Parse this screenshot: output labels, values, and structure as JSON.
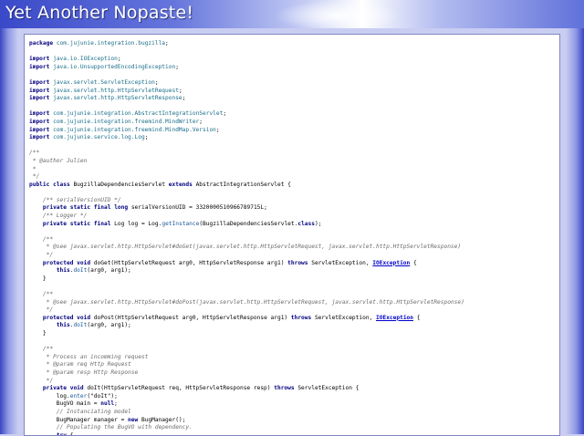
{
  "site": {
    "title": "Yet Another Nopaste!"
  },
  "code_lines": [
    [
      [
        "kw",
        "package"
      ],
      [
        "pl",
        " "
      ],
      [
        "pkg",
        "com.jujunie.integration.bugzilla"
      ],
      [
        "pl",
        ";"
      ]
    ],
    [],
    [
      [
        "kw",
        "import"
      ],
      [
        "pl",
        " "
      ],
      [
        "pkg",
        "java.io.IOException"
      ],
      [
        "pl",
        ";"
      ]
    ],
    [
      [
        "kw",
        "import"
      ],
      [
        "pl",
        " "
      ],
      [
        "pkg",
        "java.io.UnsupportedEncodingException"
      ],
      [
        "pl",
        ";"
      ]
    ],
    [],
    [
      [
        "kw",
        "import"
      ],
      [
        "pl",
        " "
      ],
      [
        "pkg",
        "javax.servlet.ServletException"
      ],
      [
        "pl",
        ";"
      ]
    ],
    [
      [
        "kw",
        "import"
      ],
      [
        "pl",
        " "
      ],
      [
        "pkg",
        "javax.servlet.http.HttpServletRequest"
      ],
      [
        "pl",
        ";"
      ]
    ],
    [
      [
        "kw",
        "import"
      ],
      [
        "pl",
        " "
      ],
      [
        "pkg",
        "javax.servlet.http.HttpServletResponse"
      ],
      [
        "pl",
        ";"
      ]
    ],
    [],
    [
      [
        "kw",
        "import"
      ],
      [
        "pl",
        " "
      ],
      [
        "pkg",
        "com.jujunie.integration.AbstractIntegrationServlet"
      ],
      [
        "pl",
        ";"
      ]
    ],
    [
      [
        "kw",
        "import"
      ],
      [
        "pl",
        " "
      ],
      [
        "pkg",
        "com.jujunie.integration.freemind.MindWriter"
      ],
      [
        "pl",
        ";"
      ]
    ],
    [
      [
        "kw",
        "import"
      ],
      [
        "pl",
        " "
      ],
      [
        "pkg",
        "com.jujunie.integration.freemind.MindMap.Version"
      ],
      [
        "pl",
        ";"
      ]
    ],
    [
      [
        "kw",
        "import"
      ],
      [
        "pl",
        " "
      ],
      [
        "pkg",
        "com.jujunie.service.log.Log"
      ],
      [
        "pl",
        ";"
      ]
    ],
    [],
    [
      [
        "cm",
        "/**"
      ]
    ],
    [
      [
        "cm",
        " * @author Julien"
      ]
    ],
    [
      [
        "cm",
        " *"
      ]
    ],
    [
      [
        "cm",
        " */"
      ]
    ],
    [
      [
        "kw",
        "public"
      ],
      [
        "pl",
        " "
      ],
      [
        "kw",
        "class"
      ],
      [
        "pl",
        " BugzillaDependenciesServlet "
      ],
      [
        "kw",
        "extends"
      ],
      [
        "pl",
        " AbstractIntegrationServlet {"
      ]
    ],
    [],
    [
      [
        "pl",
        "    "
      ],
      [
        "cm",
        "/** serialVersionUID */"
      ]
    ],
    [
      [
        "pl",
        "    "
      ],
      [
        "kw",
        "private"
      ],
      [
        "pl",
        " "
      ],
      [
        "kw",
        "static"
      ],
      [
        "pl",
        " "
      ],
      [
        "kw",
        "final"
      ],
      [
        "pl",
        " "
      ],
      [
        "kw",
        "long"
      ],
      [
        "pl",
        " serialVersionUID = "
      ],
      [
        "num",
        "3320000510966789715L"
      ],
      [
        "pl",
        ";"
      ]
    ],
    [
      [
        "pl",
        "    "
      ],
      [
        "cm",
        "/** Logger */"
      ]
    ],
    [
      [
        "pl",
        "    "
      ],
      [
        "kw",
        "private"
      ],
      [
        "pl",
        " "
      ],
      [
        "kw",
        "static"
      ],
      [
        "pl",
        " "
      ],
      [
        "kw",
        "final"
      ],
      [
        "pl",
        " Log log = Log."
      ],
      [
        "fn",
        "getInstance"
      ],
      [
        "pl",
        "(BugzillaDependenciesServlet."
      ],
      [
        "kw",
        "class"
      ],
      [
        "pl",
        ");"
      ]
    ],
    [],
    [
      [
        "pl",
        "    "
      ],
      [
        "cm",
        "/**"
      ]
    ],
    [
      [
        "pl",
        "    "
      ],
      [
        "cm",
        " * @see javax.servlet.http.HttpServlet#doGet(javax.servlet.http.HttpServletRequest, javax.servlet.http.HttpServletResponse)"
      ]
    ],
    [
      [
        "pl",
        "    "
      ],
      [
        "cm",
        " */"
      ]
    ],
    [
      [
        "pl",
        "    "
      ],
      [
        "kw",
        "protected"
      ],
      [
        "pl",
        " "
      ],
      [
        "kw",
        "void"
      ],
      [
        "pl",
        " doGet(HttpServletRequest arg0, HttpServletResponse arg1) "
      ],
      [
        "kw",
        "throws"
      ],
      [
        "pl",
        " ServletException, "
      ],
      [
        "link",
        "IOException"
      ],
      [
        "pl",
        " {"
      ]
    ],
    [
      [
        "pl",
        "        "
      ],
      [
        "kw",
        "this"
      ],
      [
        "pl",
        "."
      ],
      [
        "fn",
        "doIt"
      ],
      [
        "pl",
        "(arg0, arg1);"
      ]
    ],
    [
      [
        "pl",
        "    }"
      ]
    ],
    [],
    [
      [
        "pl",
        "    "
      ],
      [
        "cm",
        "/**"
      ]
    ],
    [
      [
        "pl",
        "    "
      ],
      [
        "cm",
        " * @see javax.servlet.http.HttpServlet#doPost(javax.servlet.http.HttpServletRequest, javax.servlet.http.HttpServletResponse)"
      ]
    ],
    [
      [
        "pl",
        "    "
      ],
      [
        "cm",
        " */"
      ]
    ],
    [
      [
        "pl",
        "    "
      ],
      [
        "kw",
        "protected"
      ],
      [
        "pl",
        " "
      ],
      [
        "kw",
        "void"
      ],
      [
        "pl",
        " doPost(HttpServletRequest arg0, HttpServletResponse arg1) "
      ],
      [
        "kw",
        "throws"
      ],
      [
        "pl",
        " ServletException, "
      ],
      [
        "link",
        "IOException"
      ],
      [
        "pl",
        " {"
      ]
    ],
    [
      [
        "pl",
        "        "
      ],
      [
        "kw",
        "this"
      ],
      [
        "pl",
        "."
      ],
      [
        "fn",
        "doIt"
      ],
      [
        "pl",
        "(arg0, arg1);"
      ]
    ],
    [
      [
        "pl",
        "    }"
      ]
    ],
    [],
    [
      [
        "pl",
        "    "
      ],
      [
        "cm",
        "/**"
      ]
    ],
    [
      [
        "pl",
        "    "
      ],
      [
        "cm",
        " * Process an incomming request"
      ]
    ],
    [
      [
        "pl",
        "    "
      ],
      [
        "cm",
        " * @param req Http Request"
      ]
    ],
    [
      [
        "pl",
        "    "
      ],
      [
        "cm",
        " * @param resp Http Response"
      ]
    ],
    [
      [
        "pl",
        "    "
      ],
      [
        "cm",
        " */"
      ]
    ],
    [
      [
        "pl",
        "    "
      ],
      [
        "kw",
        "private"
      ],
      [
        "pl",
        " "
      ],
      [
        "kw",
        "void"
      ],
      [
        "pl",
        " doIt(HttpServletRequest req, HttpServletResponse resp) "
      ],
      [
        "kw",
        "throws"
      ],
      [
        "pl",
        " ServletException {"
      ]
    ],
    [
      [
        "pl",
        "        log."
      ],
      [
        "fn",
        "enter"
      ],
      [
        "pl",
        "(\"doIt\");"
      ]
    ],
    [
      [
        "pl",
        "        BugVO main = "
      ],
      [
        "kw",
        "null"
      ],
      [
        "pl",
        ";"
      ]
    ],
    [
      [
        "pl",
        "        "
      ],
      [
        "cm",
        "// Instanciating model"
      ]
    ],
    [
      [
        "pl",
        "        BugManager manager = "
      ],
      [
        "kw",
        "new"
      ],
      [
        "pl",
        " BugManager();"
      ]
    ],
    [
      [
        "pl",
        "        "
      ],
      [
        "cm",
        "// Populating the BugVO with dependency."
      ]
    ],
    [
      [
        "pl",
        "        "
      ],
      [
        "kw",
        "try"
      ],
      [
        "pl",
        " {"
      ]
    ]
  ]
}
